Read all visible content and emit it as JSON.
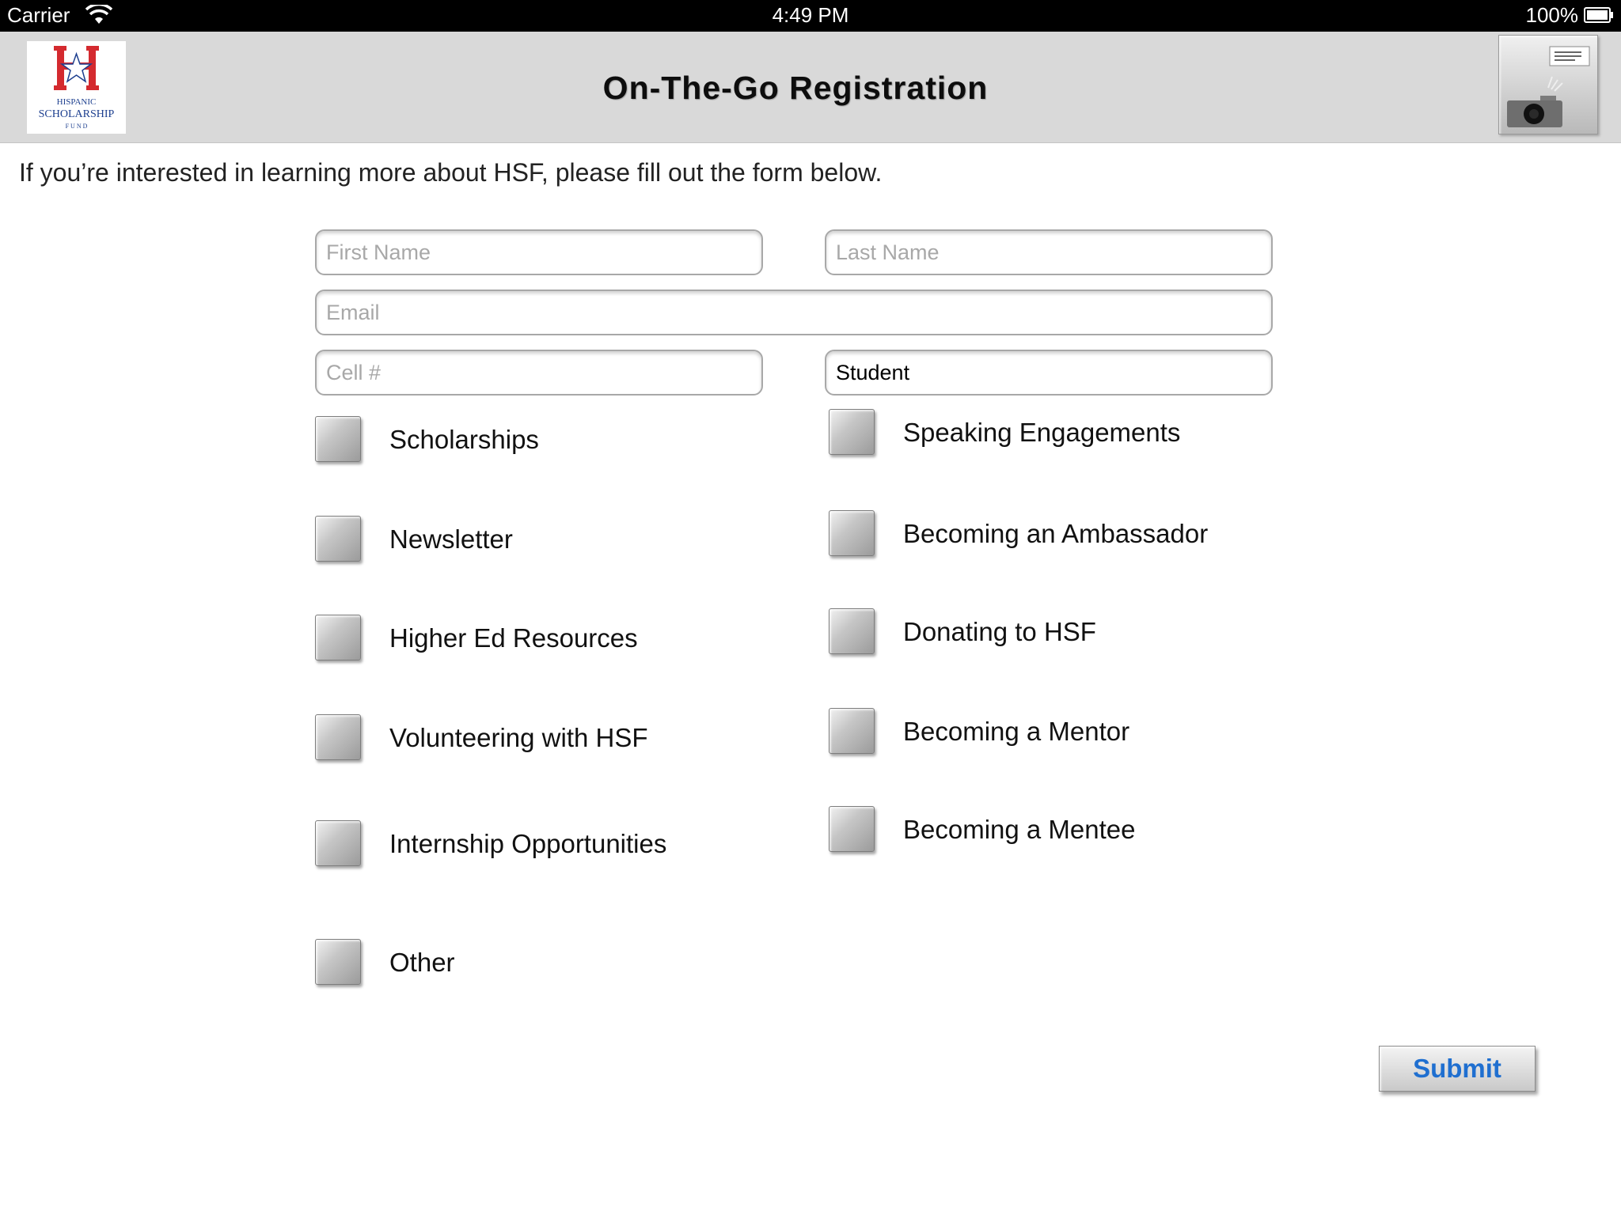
{
  "status_bar": {
    "carrier": "Carrier",
    "time": "4:49 PM",
    "battery": "100%"
  },
  "header": {
    "title": "On-The-Go Registration",
    "logo": {
      "line1": "HISPANIC",
      "line2": "SCHOLARSHIP",
      "line3": "F U N D",
      "brand_red": "#d42a2f",
      "brand_blue": "#1d3f8f"
    },
    "camera_icon": "camera-icon"
  },
  "intro": "If you’re interested in learning more about HSF, please fill out the form below.",
  "form": {
    "first_name": {
      "placeholder": "First Name",
      "value": ""
    },
    "last_name": {
      "placeholder": "Last Name",
      "value": ""
    },
    "email": {
      "placeholder": "Email",
      "value": ""
    },
    "cell": {
      "placeholder": "Cell #",
      "value": ""
    },
    "type": {
      "value": "Student"
    },
    "interests_left": [
      {
        "label": "Scholarships",
        "checked": false
      },
      {
        "label": "Newsletter",
        "checked": false
      },
      {
        "label": "Higher Ed Resources",
        "checked": false
      },
      {
        "label": "Volunteering with HSF",
        "checked": false
      },
      {
        "label": "Internship Opportunities",
        "checked": false
      },
      {
        "label": "Other",
        "checked": false
      }
    ],
    "interests_right": [
      {
        "label": "Speaking Engagements",
        "checked": false
      },
      {
        "label": "Becoming an Ambassador",
        "checked": false
      },
      {
        "label": "Donating to HSF",
        "checked": false
      },
      {
        "label": "Becoming a Mentor",
        "checked": false
      },
      {
        "label": "Becoming a Mentee",
        "checked": false
      }
    ],
    "submit_label": "Submit"
  },
  "colors": {
    "submit_text": "#1f6fd0",
    "header_bg": "#d9d9d9"
  }
}
